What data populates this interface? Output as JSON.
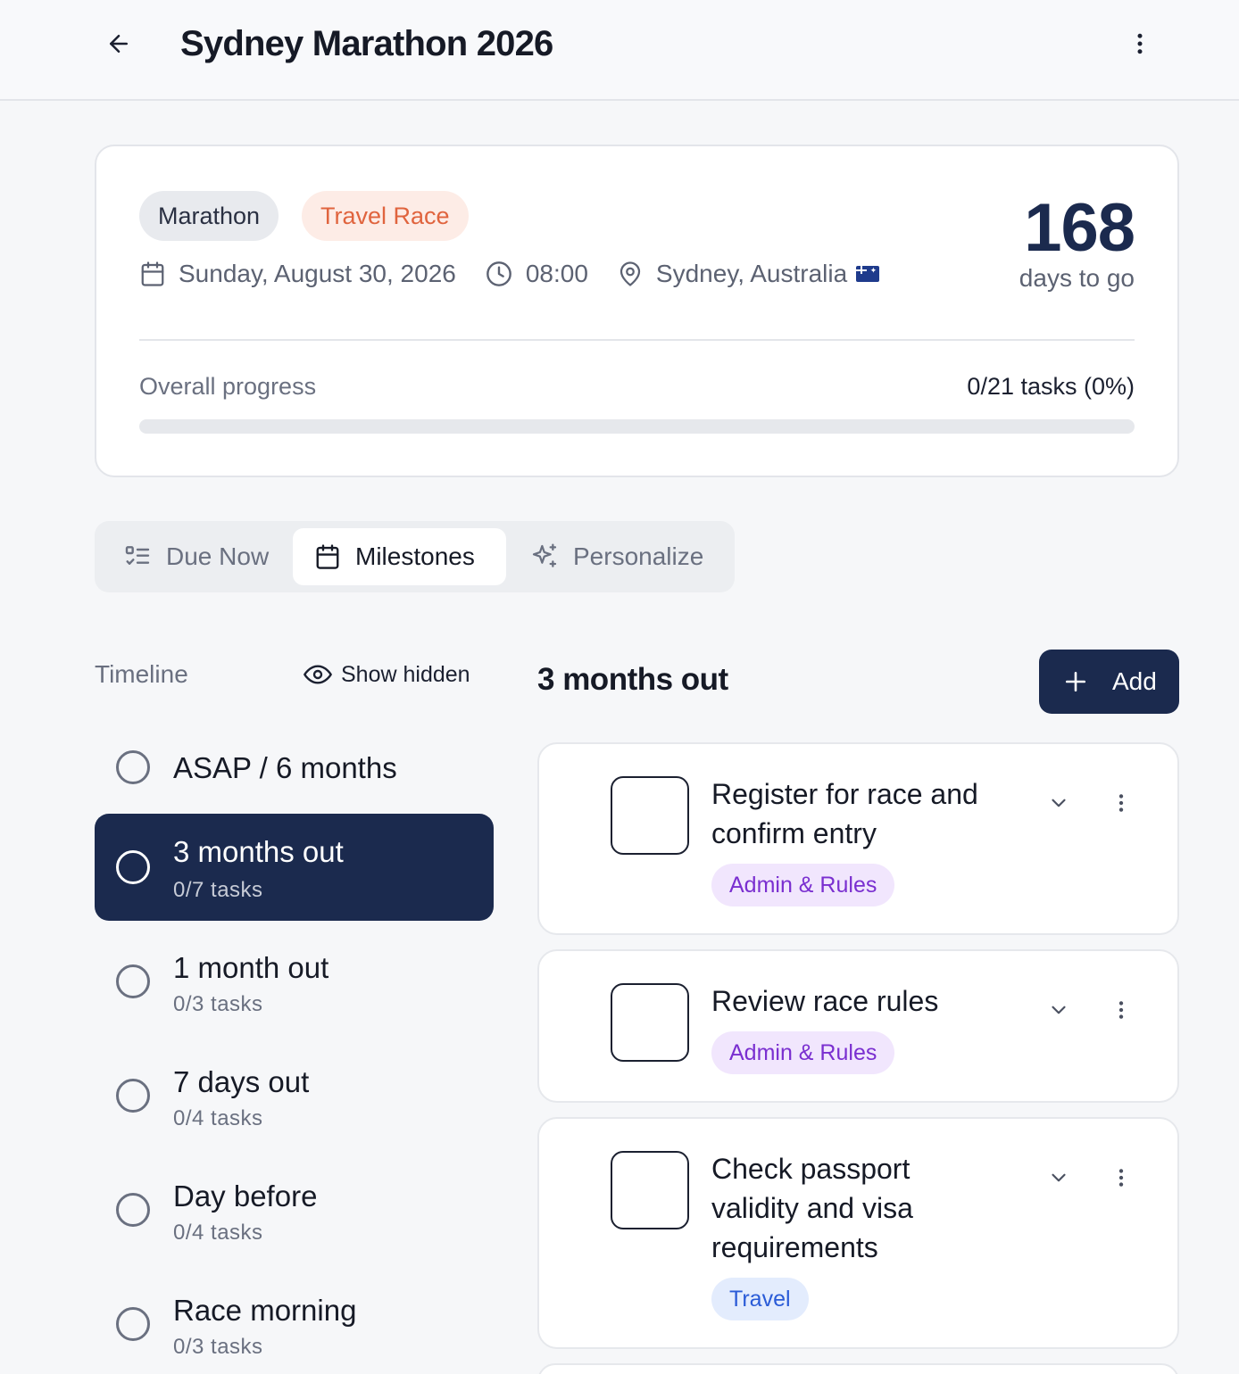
{
  "header": {
    "title": "Sydney Marathon 2026"
  },
  "summary": {
    "tags": [
      "Marathon",
      "Travel Race"
    ],
    "date": "Sunday, August 30, 2026",
    "time": "08:00",
    "location": "Sydney, Australia",
    "days_count": "168",
    "days_label": "days to go",
    "progress_label": "Overall progress",
    "progress_value": "0/21 tasks (0%)",
    "progress_fraction": 0
  },
  "tabs": [
    {
      "label": "Due Now",
      "icon": "list-check-icon"
    },
    {
      "label": "Milestones",
      "icon": "calendar-icon",
      "selected": true
    },
    {
      "label": "Personalize",
      "icon": "sparkles-icon"
    }
  ],
  "timeline": {
    "heading": "Timeline",
    "show_hidden": "Show hidden",
    "items": [
      {
        "title": "ASAP / 6 months",
        "sub": ""
      },
      {
        "title": "3 months out",
        "sub": "0/7 tasks",
        "active": true
      },
      {
        "title": "1 month out",
        "sub": "0/3 tasks"
      },
      {
        "title": "7 days out",
        "sub": "0/4 tasks"
      },
      {
        "title": "Day before",
        "sub": "0/4 tasks"
      },
      {
        "title": "Race morning",
        "sub": "0/3 tasks"
      }
    ]
  },
  "section": {
    "title": "3 months out",
    "add_label": "Add"
  },
  "tasks": [
    {
      "title": "Register for race and confirm entry",
      "category": "Admin & Rules"
    },
    {
      "title": "Review race rules",
      "category": "Admin & Rules"
    },
    {
      "title": "Check passport validity and visa requirements",
      "category": "Travel"
    }
  ],
  "colors": {
    "accent": "#1b2a4e",
    "travel_tag": "#e0643e",
    "admin_chip": "#7a2fd0",
    "travel_chip": "#2a5bd7"
  }
}
